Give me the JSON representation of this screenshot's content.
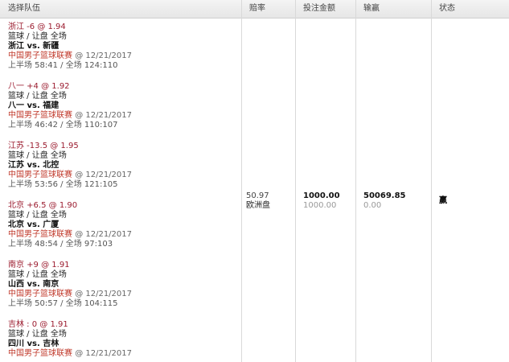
{
  "headers": {
    "team": "选择队伍",
    "odds": "赔率",
    "stake": "投注金额",
    "winloss": "输赢",
    "status": "状态"
  },
  "bets": [
    {
      "selection": "浙江 -6 @ 1.94",
      "market": "篮球 / 让盘 全场",
      "match": "浙江 vs. 新疆",
      "league": "中国男子篮球联赛",
      "date": "@ 12/21/2017",
      "score": "上半场 58:41 / 全场 124:110"
    },
    {
      "selection": "八一 +4 @ 1.92",
      "market": "篮球 / 让盘 全场",
      "match": "八一 vs. 福建",
      "league": "中国男子篮球联赛",
      "date": "@ 12/21/2017",
      "score": "上半场 46:42 / 全场 110:107"
    },
    {
      "selection": "江苏 -13.5 @ 1.95",
      "market": "篮球 / 让盘 全场",
      "match": "江苏 vs. 北控",
      "league": "中国男子篮球联赛",
      "date": "@ 12/21/2017",
      "score": "上半场 53:56 / 全场 121:105"
    },
    {
      "selection": "北京 +6.5 @ 1.90",
      "market": "篮球 / 让盘 全场",
      "match": "北京 vs. 广厦",
      "league": "中国男子篮球联赛",
      "date": "@ 12/21/2017",
      "score": "上半场 48:54 / 全场 97:103"
    },
    {
      "selection": "南京 +9 @ 1.91",
      "market": "篮球 / 让盘 全场",
      "match": "山西 vs. 南京",
      "league": "中国男子篮球联赛",
      "date": "@ 12/21/2017",
      "score": "上半场 50:57 / 全场 104:115"
    },
    {
      "selection": "吉林 : 0 @ 1.91",
      "market": "篮球 / 让盘 全场",
      "match": "四川 vs. 吉林",
      "league": "中国男子篮球联赛",
      "date": "@ 12/21/2017",
      "score": ""
    }
  ],
  "summary": {
    "odds": "50.97",
    "odds_type": "欧洲盘",
    "stake": "1000.00",
    "stake_sub": "1000.00",
    "winloss": "50069.85",
    "winloss_sub": "0.00",
    "status": "赢"
  },
  "colors": {
    "selection": "#9b1c2f",
    "league": "#c0392b",
    "header_bg": "#ececec"
  }
}
